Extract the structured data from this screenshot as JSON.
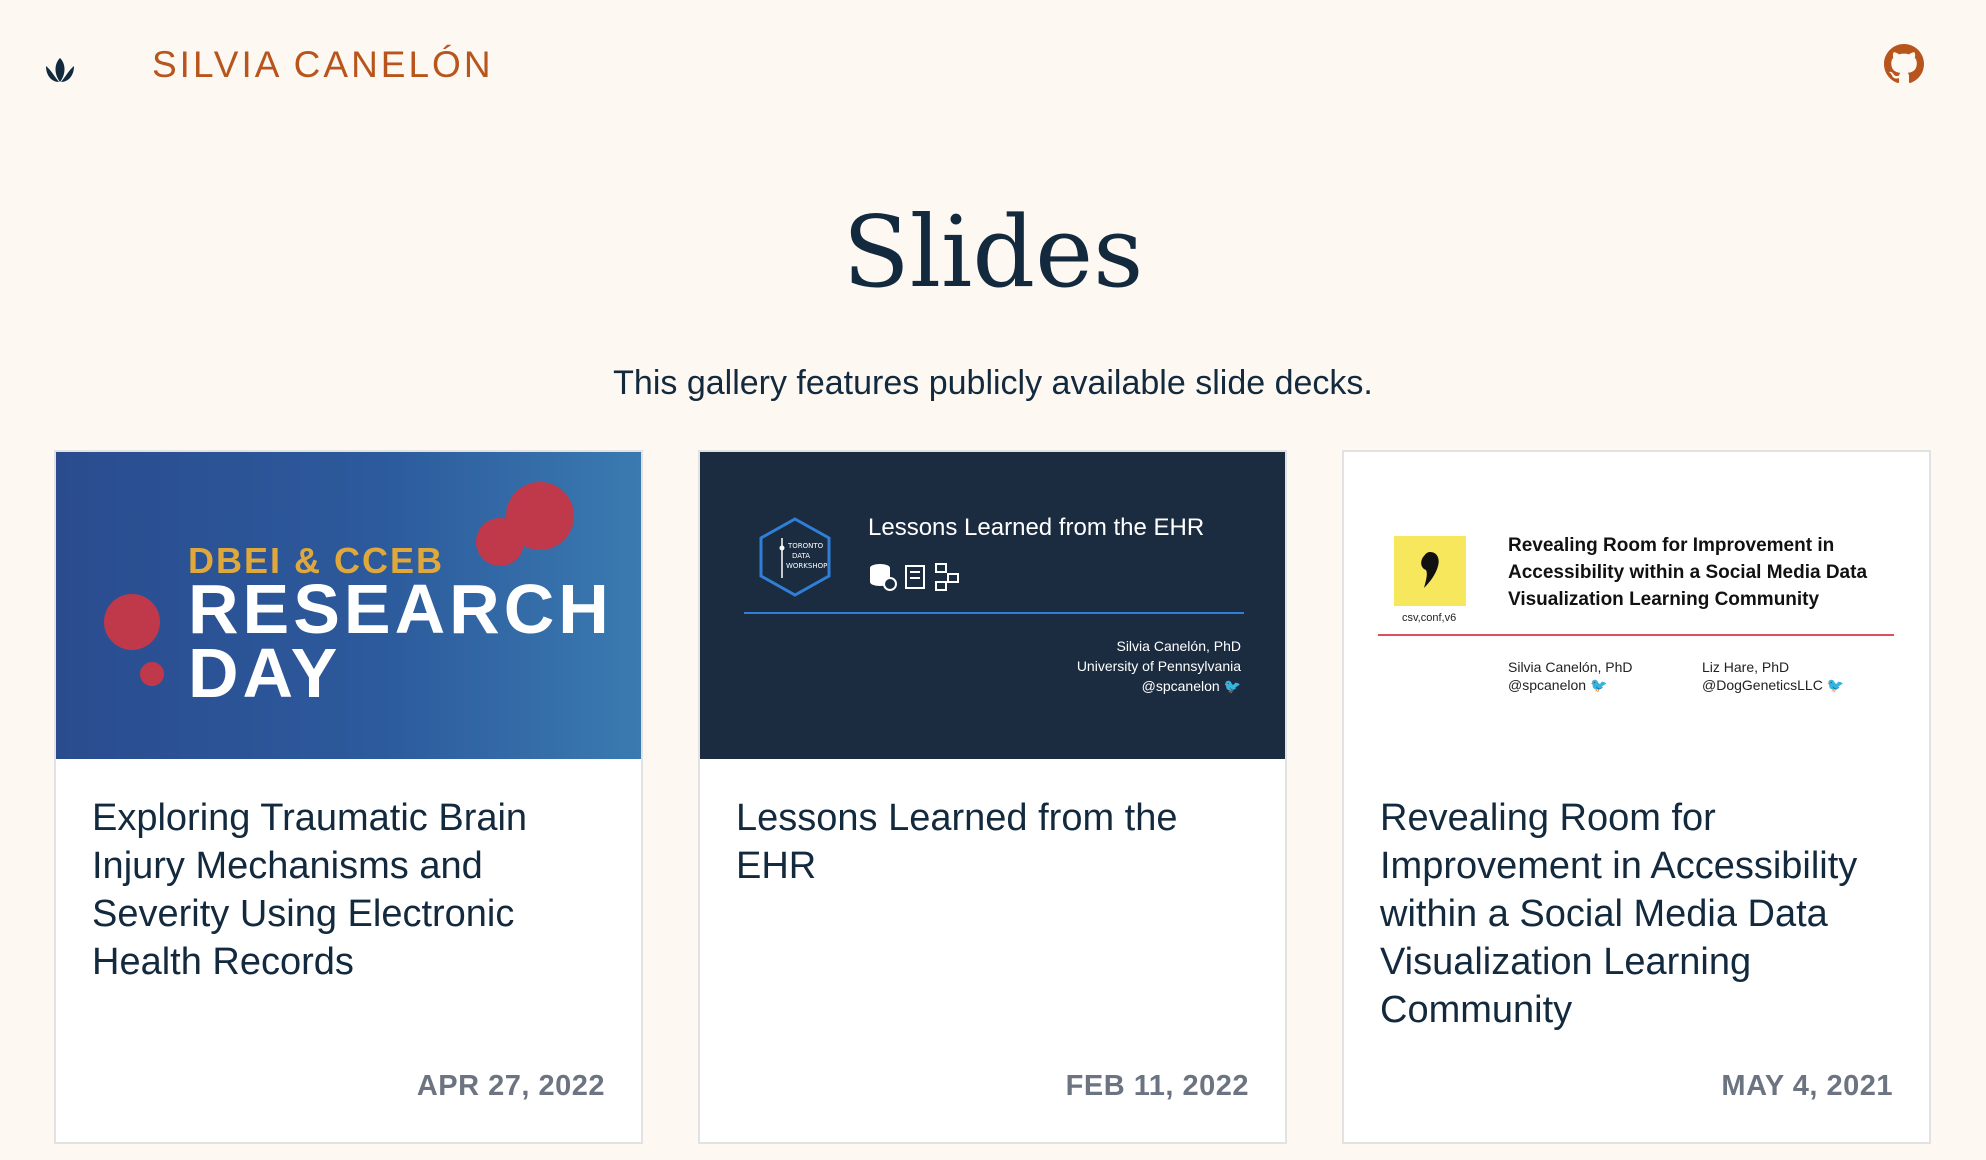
{
  "header": {
    "site_title": "SILVIA CANELÓN",
    "logo_icon": "lotus-icon",
    "github_icon": "github-icon"
  },
  "page": {
    "title": "Slides",
    "description": "This gallery features publicly available slide decks."
  },
  "colors": {
    "background": "#fdf8f2",
    "accent": "#b8551c",
    "heading": "#13293d",
    "date": "#6b7480"
  },
  "cards": [
    {
      "title": "Exploring Traumatic Brain Injury Mechanisms and Severity Using Electronic Health Records",
      "date": "APR 27, 2022",
      "thumb": {
        "kicker": "DBEI & CCEB",
        "line1": "RESEARCH",
        "line2": "DAY"
      }
    },
    {
      "title": "Lessons Learned from the EHR",
      "date": "FEB 11, 2022",
      "thumb": {
        "title": "Lessons Learned from the EHR",
        "badge": "TORONTO DATA WORKSHOP",
        "author": "Silvia Canelón, PhD",
        "affiliation": "University of Pennsylvania",
        "handle": "@spcanelon"
      }
    },
    {
      "title": "Revealing Room for Improvement in Accessibility within a Social Media Data Visualization Learning Community",
      "date": "MAY 4, 2021",
      "thumb": {
        "title": "Revealing Room for Improvement in Accessibility within a Social Media Data Visualization Learning Community",
        "conf": "csv,conf,v6",
        "author1": "Silvia Canelón, PhD",
        "handle1": "@spcanelon",
        "author2": "Liz Hare, PhD",
        "handle2": "@DogGeneticsLLC"
      }
    }
  ]
}
